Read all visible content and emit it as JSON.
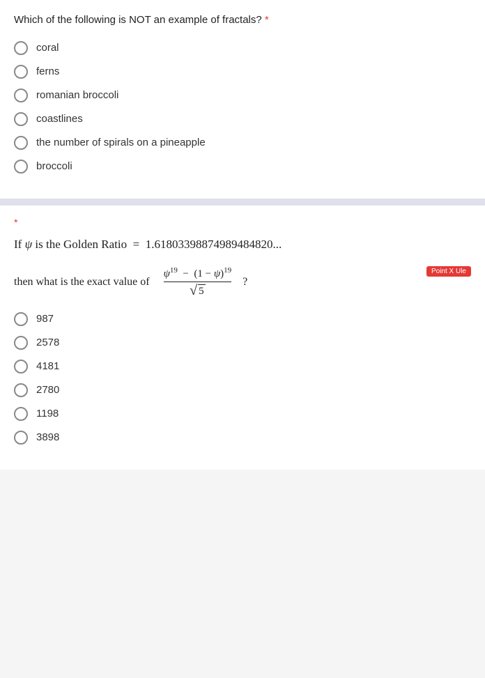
{
  "section1": {
    "question": "Which of the following is NOT an example of fractals?",
    "required_marker": "*",
    "options": [
      {
        "id": "opt1",
        "label": "coral"
      },
      {
        "id": "opt2",
        "label": "ferns"
      },
      {
        "id": "opt3",
        "label": "romanian broccoli"
      },
      {
        "id": "opt4",
        "label": "coastlines"
      },
      {
        "id": "opt5",
        "label": "the number of spirals on a pineapple"
      },
      {
        "id": "opt6",
        "label": "broccoli"
      }
    ]
  },
  "section2": {
    "asterisk": "*",
    "golden_ratio_line": "If ψ is the Golden Ratio  =  1.61803398874989484820...",
    "then_text": "then what is the exact value of",
    "numerator_text": "ψ¹⁹ − (1 − ψ)¹⁹",
    "denominator_text": "√5",
    "question_mark": "?",
    "point_badge": "Point X Ule",
    "options": [
      {
        "id": "q2opt1",
        "label": "987"
      },
      {
        "id": "q2opt2",
        "label": "2578"
      },
      {
        "id": "q2opt3",
        "label": "4181"
      },
      {
        "id": "q2opt4",
        "label": "2780"
      },
      {
        "id": "q2opt5",
        "label": "1198"
      },
      {
        "id": "q2opt6",
        "label": "3898"
      }
    ]
  }
}
